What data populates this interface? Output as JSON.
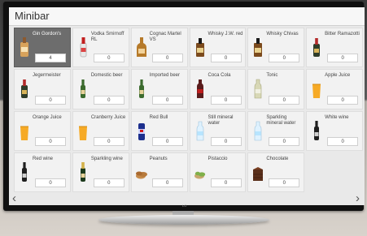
{
  "app": {
    "title": "Minibar",
    "brand": "LG"
  },
  "items": [
    {
      "label": "Gin Gordon's",
      "qty": "4",
      "icon": "gin-bottle-icon",
      "selected": true
    },
    {
      "label": "Vodka Smirnoff RL",
      "qty": "0",
      "icon": "vodka-bottle-icon"
    },
    {
      "label": "Cognac Martel VS",
      "qty": "0",
      "icon": "cognac-bottle-icon"
    },
    {
      "label": "Whisky J.W. red",
      "qty": "0",
      "icon": "whisky-bottle-icon"
    },
    {
      "label": "Whisky Chivas",
      "qty": "0",
      "icon": "whisky-bottle-icon"
    },
    {
      "label": "Bitter Ramazotti",
      "qty": "0",
      "icon": "liqueur-bottle-icon"
    },
    {
      "label": "Jegermeister",
      "qty": "0",
      "icon": "liqueur-bottle-icon"
    },
    {
      "label": "Domestic beer",
      "qty": "0",
      "icon": "beer-bottle-icon"
    },
    {
      "label": "Imported beer",
      "qty": "0",
      "icon": "beer-bottle-icon"
    },
    {
      "label": "Coca Cola",
      "qty": "0",
      "icon": "soda-bottle-icon"
    },
    {
      "label": "Tonic",
      "qty": "0",
      "icon": "tonic-bottle-icon"
    },
    {
      "label": "Apple Juice",
      "qty": "0",
      "icon": "juice-glass-icon"
    },
    {
      "label": "Orange Juice",
      "qty": "0",
      "icon": "juice-glass-icon"
    },
    {
      "label": "Cranberry Juice",
      "qty": "0",
      "icon": "juice-glass-icon"
    },
    {
      "label": "Red Bull",
      "qty": "0",
      "icon": "energy-can-icon"
    },
    {
      "label": "Still mineral water",
      "qty": "0",
      "icon": "water-bottle-icon"
    },
    {
      "label": "Sparkling mineral water",
      "qty": "0",
      "icon": "water-bottle-icon"
    },
    {
      "label": "White wine",
      "qty": "0",
      "icon": "wine-bottle-icon"
    },
    {
      "label": "Red wine",
      "qty": "0",
      "icon": "wine-bottle-icon"
    },
    {
      "label": "Sparkling wine",
      "qty": "0",
      "icon": "sparkling-wine-icon"
    },
    {
      "label": "Peanuts",
      "qty": "0",
      "icon": "peanuts-icon"
    },
    {
      "label": "Pistaccio",
      "qty": "0",
      "icon": "pistachio-icon"
    },
    {
      "label": "Chocolate",
      "qty": "0",
      "icon": "chocolate-icon"
    }
  ],
  "nav": {
    "prev": "‹",
    "next": "›"
  }
}
